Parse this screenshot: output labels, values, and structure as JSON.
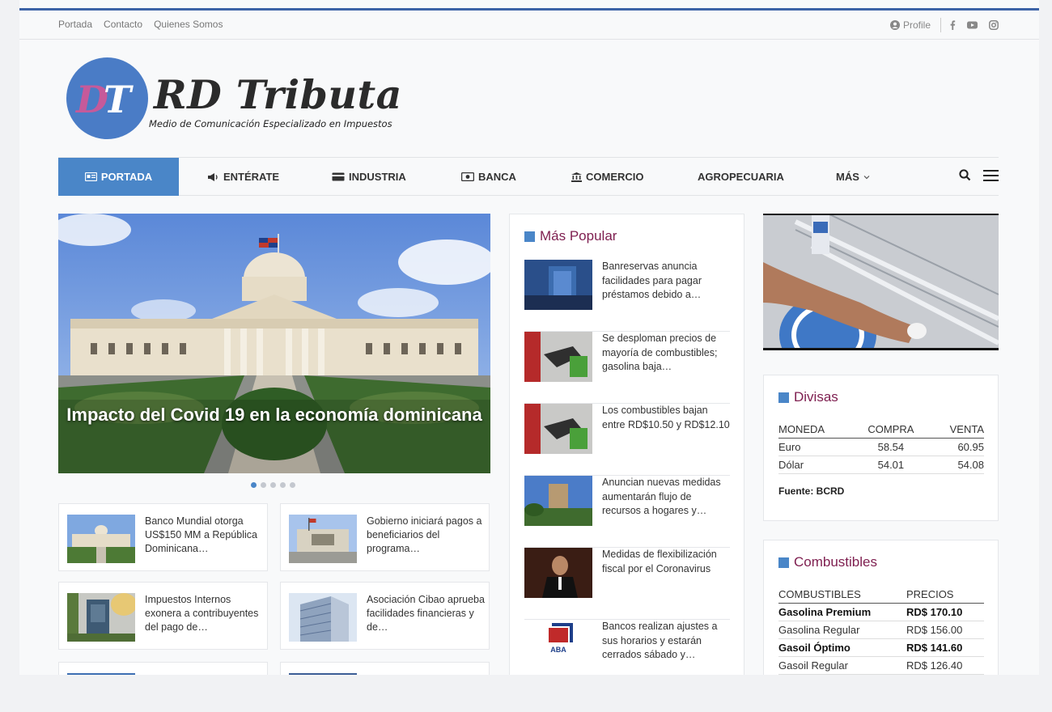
{
  "topbar": {
    "links": [
      "Portada",
      "Contacto",
      "Quienes Somos"
    ],
    "profile": "Profile",
    "social_icons": [
      "facebook-icon",
      "youtube-icon",
      "instagram-icon"
    ]
  },
  "logo": {
    "mark_d": "D",
    "mark_t": "T",
    "title": "RD Tributa",
    "subtitle": "Medio de Comunicación Especializado en Impuestos"
  },
  "nav": {
    "items": [
      "PORTADA",
      "ENTÉRATE",
      "INDUSTRIA",
      "BANCA",
      "COMERCIO",
      "AGROPECUARIA",
      "MÁS"
    ],
    "active_index": 0
  },
  "slider": {
    "caption": "Impacto del Covid 19 en la economía dominicana",
    "dot_count": 5,
    "active_dot": 0
  },
  "cards": [
    {
      "text": "Banco Mundial otorga US$150 MM a República Dominicana…"
    },
    {
      "text": "Gobierno iniciará pagos a beneficiarios del programa…"
    },
    {
      "text": "Impuestos Internos exonera a contribuyentes del pago de…"
    },
    {
      "text": "Asociación Cibao aprueba facilidades financieras y de…"
    }
  ],
  "popular": {
    "title": "Más Popular",
    "items": [
      {
        "text": "Banreservas anuncia facilidades para pagar préstamos debido a…"
      },
      {
        "text": "Se desploman precios de mayoría de combustibles; gasolina baja…"
      },
      {
        "text": "Los combustibles bajan entre RD$10.50 y RD$12.10"
      },
      {
        "text": "Anuncian nuevas medidas aumentarán flujo de recursos a hogares y…"
      },
      {
        "text": "Medidas de flexibilización fiscal por el Coronavirus"
      },
      {
        "text": "Bancos realizan ajustes a sus horarios y estarán cerrados sábado y…",
        "thumb_label": "ABA"
      }
    ]
  },
  "divisas": {
    "title": "Divisas",
    "headers": [
      "MONEDA",
      "COMPRA",
      "VENTA"
    ],
    "rows": [
      {
        "moneda": "Euro",
        "compra": "58.54",
        "venta": "60.95"
      },
      {
        "moneda": "Dólar",
        "compra": "54.01",
        "venta": "54.08"
      }
    ],
    "fuente": "Fuente: BCRD"
  },
  "combustibles": {
    "title": "Combustibles",
    "headers": [
      "COMBUSTIBLES",
      "PRECIOS"
    ],
    "rows": [
      {
        "name": "Gasolina Premium",
        "price": "RD$ 170.10",
        "bold": true
      },
      {
        "name": "Gasolina Regular",
        "price": "RD$ 156.00",
        "bold": false
      },
      {
        "name": "Gasoil Óptimo",
        "price": "RD$ 141.60",
        "bold": true
      },
      {
        "name": "Gasoil Regular",
        "price": "RD$ 126.40",
        "bold": false
      }
    ]
  },
  "colors": {
    "accent": "#4a86c8",
    "heading": "#7e1e4f",
    "top_line": "#3d63a6"
  }
}
